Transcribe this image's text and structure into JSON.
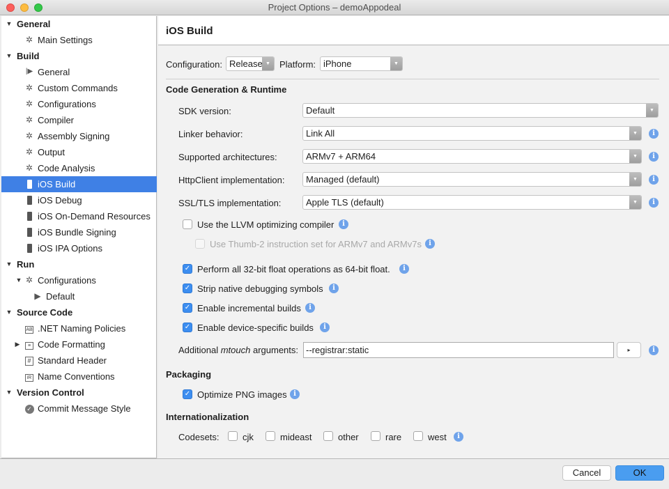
{
  "window": {
    "title": "Project Options – demoAppodeal"
  },
  "sidebar": {
    "items": [
      {
        "label": "General",
        "type": "category",
        "expanded": true
      },
      {
        "label": "Main Settings",
        "icon": "gear-icon"
      },
      {
        "label": "Build",
        "type": "category",
        "expanded": true
      },
      {
        "label": "General",
        "icon": "play-bar-icon"
      },
      {
        "label": "Custom Commands",
        "icon": "gear-icon"
      },
      {
        "label": "Configurations",
        "icon": "gear-icon"
      },
      {
        "label": "Compiler",
        "icon": "gear-icon"
      },
      {
        "label": "Assembly Signing",
        "icon": "gear-icon"
      },
      {
        "label": "Output",
        "icon": "gear-icon"
      },
      {
        "label": "Code Analysis",
        "icon": "gear-icon"
      },
      {
        "label": "iOS Build",
        "icon": "phone-icon",
        "selected": true
      },
      {
        "label": "iOS Debug",
        "icon": "phone-icon"
      },
      {
        "label": "iOS On-Demand Resources",
        "icon": "phone-icon"
      },
      {
        "label": "iOS Bundle Signing",
        "icon": "phone-icon"
      },
      {
        "label": "iOS IPA Options",
        "icon": "phone-icon"
      },
      {
        "label": "Run",
        "type": "category",
        "expanded": true
      },
      {
        "label": "Configurations",
        "icon": "gear-icon",
        "expanded": true
      },
      {
        "label": "Default",
        "icon": "play-icon"
      },
      {
        "label": "Source Code",
        "type": "category",
        "expanded": true
      },
      {
        "label": ".NET Naming Policies",
        "icon": "ab-icon"
      },
      {
        "label": "Code Formatting",
        "icon": "format-icon",
        "expanded": false
      },
      {
        "label": "Standard Header",
        "icon": "hash-icon"
      },
      {
        "label": "Name Conventions",
        "icon": "ir-icon"
      },
      {
        "label": "Version Control",
        "type": "category",
        "expanded": true
      },
      {
        "label": "Commit Message Style",
        "icon": "check-circle-icon"
      }
    ]
  },
  "header": {
    "title": "iOS Build"
  },
  "config": {
    "configuration_label": "Configuration:",
    "configuration_value": "Release",
    "platform_label": "Platform:",
    "platform_value": "iPhone"
  },
  "codegen": {
    "title": "Code Generation & Runtime",
    "sdk_label": "SDK version:",
    "sdk_value": "Default",
    "linker_label": "Linker behavior:",
    "linker_value": "Link All",
    "arch_label": "Supported architectures:",
    "arch_value": "ARMv7 + ARM64",
    "http_label": "HttpClient implementation:",
    "http_value": "Managed (default)",
    "ssl_label": "SSL/TLS implementation:",
    "ssl_value": "Apple TLS (default)",
    "llvm_label": "Use the LLVM optimizing compiler",
    "llvm_checked": false,
    "thumb_label": "Use Thumb-2 instruction set for ARMv7 and ARMv7s",
    "thumb_checked": false,
    "float_label": "Perform all 32-bit float operations as 64-bit float.",
    "float_checked": true,
    "strip_label": "Strip native debugging symbols",
    "strip_checked": true,
    "incremental_label": "Enable incremental builds",
    "incremental_checked": true,
    "device_label": "Enable device-specific builds",
    "device_checked": true,
    "mtouch_label_prefix": "Additional ",
    "mtouch_label_italic": "mtouch",
    "mtouch_label_suffix": " arguments:",
    "mtouch_value": "--registrar:static",
    "mtouch_button": "▸"
  },
  "packaging": {
    "title": "Packaging",
    "png_label": "Optimize PNG images",
    "png_checked": true
  },
  "i18n": {
    "title": "Internationalization",
    "codesets_label": "Codesets:",
    "codesets": [
      {
        "label": "cjk",
        "checked": false
      },
      {
        "label": "mideast",
        "checked": false
      },
      {
        "label": "other",
        "checked": false
      },
      {
        "label": "rare",
        "checked": false
      },
      {
        "label": "west",
        "checked": false
      }
    ]
  },
  "footer": {
    "cancel": "Cancel",
    "ok": "OK"
  },
  "colors": {
    "accent": "#3f80e5",
    "ok_button": "#4a9df0",
    "info": "#6fa3ea",
    "checkbox": "#3d8ef0"
  }
}
